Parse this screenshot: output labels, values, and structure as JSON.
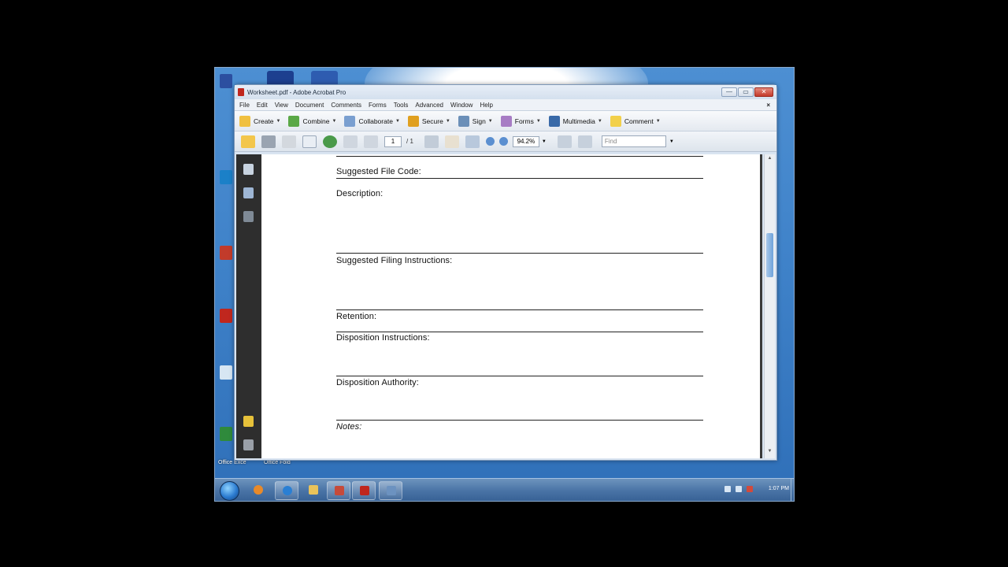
{
  "window": {
    "title": "Worksheet.pdf - Adobe Acrobat Pro",
    "controls": {
      "minimize": "—",
      "maximize": "▭",
      "close": "✕"
    }
  },
  "menu": {
    "items": [
      "File",
      "Edit",
      "View",
      "Document",
      "Comments",
      "Forms",
      "Tools",
      "Advanced",
      "Window",
      "Help"
    ],
    "close": "×"
  },
  "toolbar": {
    "create": "Create",
    "combine": "Combine",
    "collaborate": "Collaborate",
    "secure": "Secure",
    "sign": "Sign",
    "forms": "Forms",
    "multimedia": "Multimedia",
    "comment": "Comment"
  },
  "nav": {
    "page_current": "1",
    "page_total": "/ 1",
    "zoom": "94.2%",
    "find_placeholder": "Find"
  },
  "document": {
    "fields": [
      "Suggested File Code:",
      "Description:",
      "Suggested Filing Instructions:",
      "Retention:",
      "Disposition Instructions:",
      "Disposition Authority:",
      "Notes:"
    ]
  },
  "desktop": {
    "labels": [
      "Office Exce",
      "Office Fold"
    ]
  },
  "taskbar": {
    "clock": "1:07 PM"
  },
  "colors": {
    "acrobat_red": "#c0271e",
    "desktop_blue": "#3f82c9"
  }
}
